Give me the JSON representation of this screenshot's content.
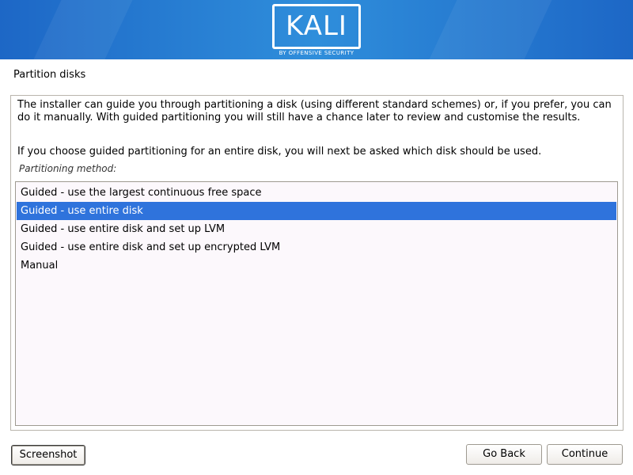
{
  "header": {
    "logo_text": "KALI",
    "logo_subtitle": "BY OFFENSIVE SECURITY",
    "banner_color": "#2a80d6"
  },
  "page": {
    "title": "Partition disks",
    "description_1": "The installer can guide you through partitioning a disk (using different standard schemes) or, if you prefer, you can do it manually. With guided partitioning you will still have a chance later to review and customise the results.",
    "description_2": "If you choose guided partitioning for an entire disk, you will next be asked which disk should be used.",
    "field_label": "Partitioning method:"
  },
  "methods": {
    "items": [
      {
        "label": "Guided - use the largest continuous free space",
        "selected": false
      },
      {
        "label": "Guided - use entire disk",
        "selected": true
      },
      {
        "label": "Guided - use entire disk and set up LVM",
        "selected": false
      },
      {
        "label": "Guided - use entire disk and set up encrypted LVM",
        "selected": false
      },
      {
        "label": "Manual",
        "selected": false
      }
    ],
    "selected_color": "#2f73dc"
  },
  "buttons": {
    "screenshot": "Screenshot",
    "go_back": "Go Back",
    "continue": "Continue"
  }
}
